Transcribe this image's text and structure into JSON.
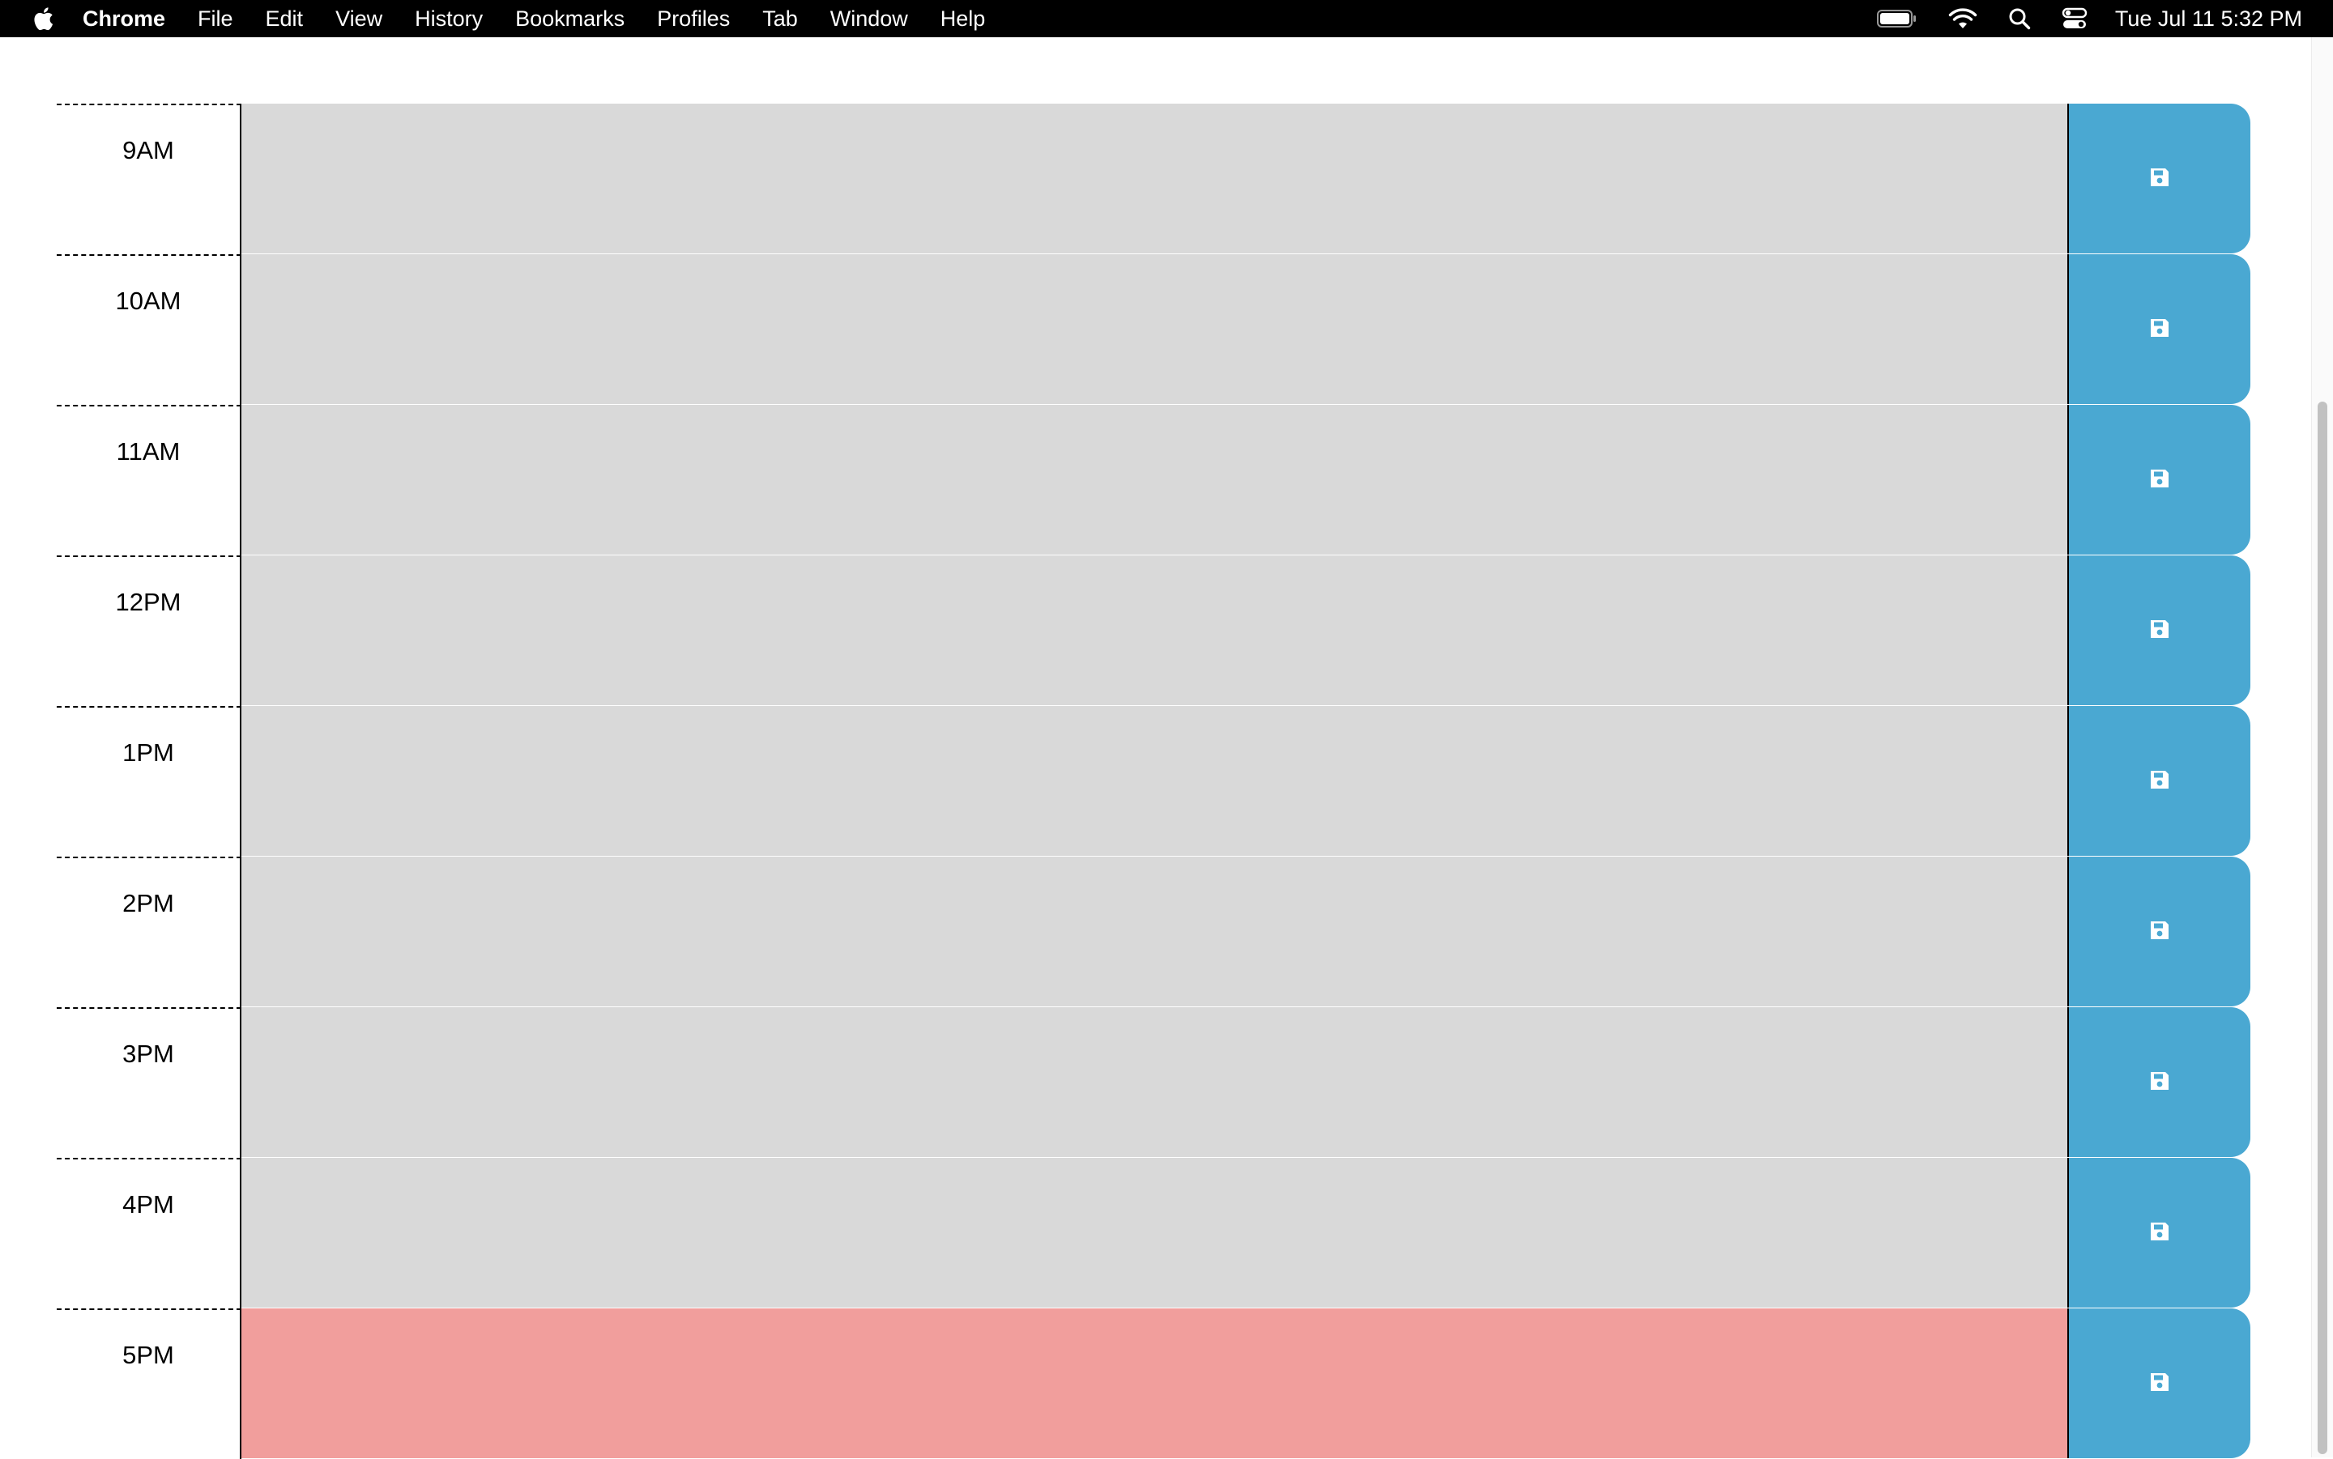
{
  "menubar": {
    "app_name": "Chrome",
    "items": [
      "File",
      "Edit",
      "View",
      "History",
      "Bookmarks",
      "Profiles",
      "Tab",
      "Window",
      "Help"
    ],
    "clock": "Tue Jul 11  5:32 PM"
  },
  "colors": {
    "past": "#d9d9d9",
    "present": "#f19e9c",
    "save_button": "#4aa8d2"
  },
  "planner": {
    "rows": [
      {
        "hour": "9AM",
        "status": "past",
        "text": ""
      },
      {
        "hour": "10AM",
        "status": "past",
        "text": ""
      },
      {
        "hour": "11AM",
        "status": "past",
        "text": ""
      },
      {
        "hour": "12PM",
        "status": "past",
        "text": ""
      },
      {
        "hour": "1PM",
        "status": "past",
        "text": ""
      },
      {
        "hour": "2PM",
        "status": "past",
        "text": ""
      },
      {
        "hour": "3PM",
        "status": "past",
        "text": ""
      },
      {
        "hour": "4PM",
        "status": "past",
        "text": ""
      },
      {
        "hour": "5PM",
        "status": "present",
        "text": ""
      }
    ],
    "save_icon": "floppy-disk-icon"
  }
}
